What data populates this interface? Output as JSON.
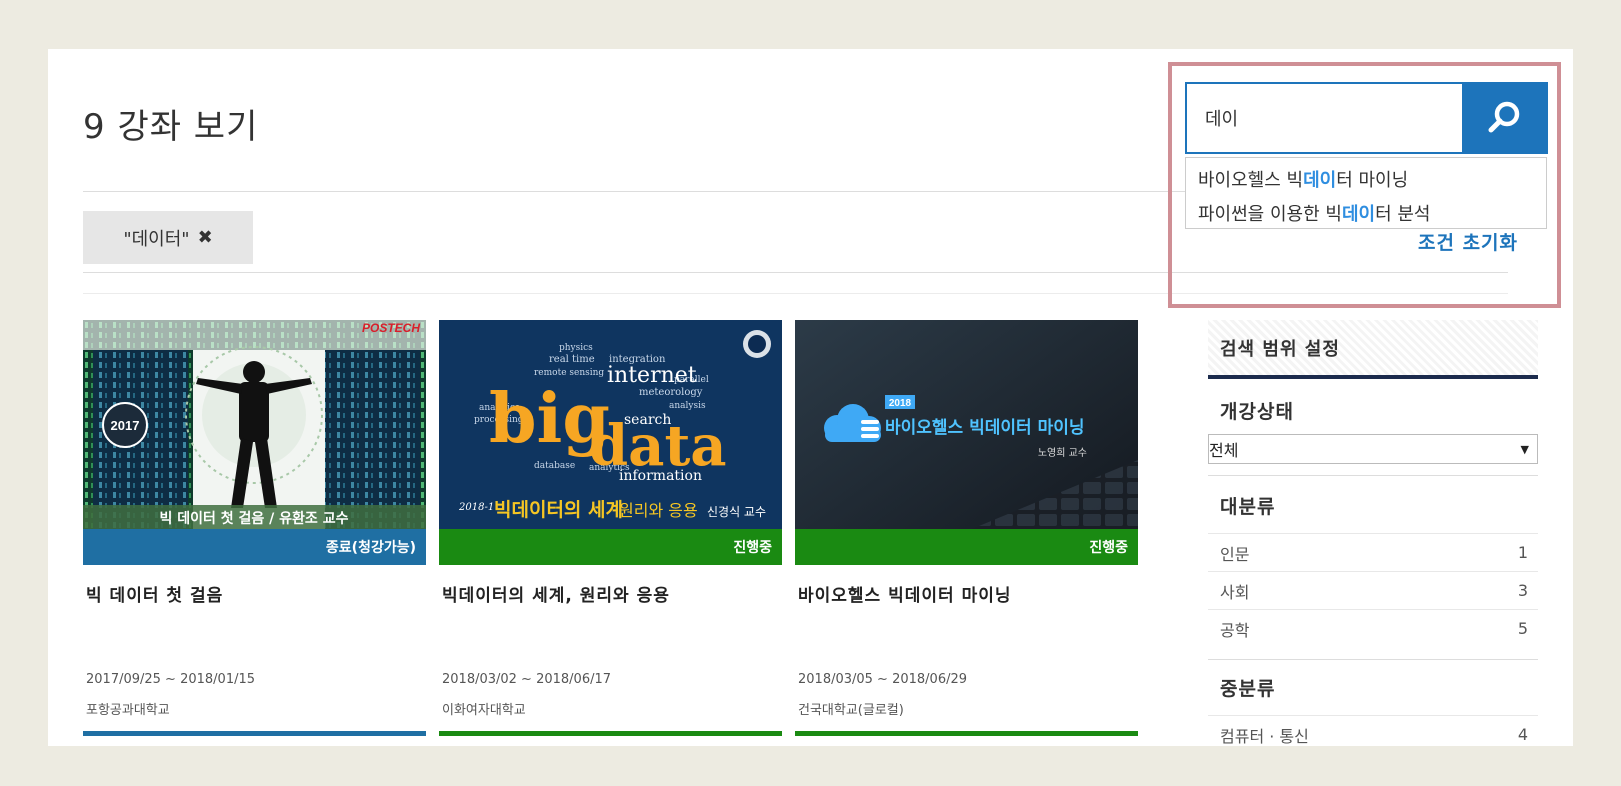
{
  "header": {
    "title": "9 강좌 보기"
  },
  "filter": {
    "chip_label": "\"데이터\"",
    "remove_icon": "✖"
  },
  "search": {
    "value": "데이",
    "placeholder": "",
    "icon": "search-icon",
    "suggestions": [
      {
        "prefix": "바이오헬스 빅",
        "match": "데이",
        "suffix": "터 마이닝"
      },
      {
        "prefix": "파이썬을 이용한 빅",
        "match": "데이",
        "suffix": "터 분석"
      }
    ],
    "reset_label": "조건 초기화"
  },
  "cards": [
    {
      "thumb": {
        "brand": "POSTECH",
        "year": "2017",
        "caption": "빅 데이터 첫 걸음 / 유환조 교수"
      },
      "status": "종료(청강가능)",
      "status_color": "#1f6fa3",
      "title": "빅 데이터 첫 걸음",
      "dates": "2017/09/25 ~ 2018/01/15",
      "school": "포항공과대학교"
    },
    {
      "thumb": {
        "big": "big",
        "data": "data",
        "w1": "internet",
        "w2": "search",
        "w3": "information",
        "term": "2018-1",
        "caption_a": "빅데이터의 세계",
        "caption_b": "원리와 응용",
        "prof": "신경식 교수"
      },
      "status": "진행중",
      "status_color": "#1a8a12",
      "title": "빅데이터의 세계, 원리와 응용",
      "dates": "2018/03/02 ~ 2018/06/17",
      "school": "이화여자대학교"
    },
    {
      "thumb": {
        "year": "2018",
        "caption": "바이오헬스 빅데이터 마이닝",
        "prof": "노영희 교수"
      },
      "status": "진행중",
      "status_color": "#1a8a12",
      "title": "바이오헬스 빅데이터 마이닝",
      "dates": "2018/03/05 ~ 2018/06/29",
      "school": "건국대학교(글로컬)"
    }
  ],
  "sidebar": {
    "heading": "검색 범위 설정",
    "status_label": "개강상태",
    "status_select": "전체",
    "major_label": "대분류",
    "major_items": [
      {
        "name": "인문",
        "count": "1"
      },
      {
        "name": "사회",
        "count": "3"
      },
      {
        "name": "공학",
        "count": "5"
      }
    ],
    "middle_label": "중분류",
    "middle_items": [
      {
        "name": "컴퓨터 · 통신",
        "count": "4"
      }
    ]
  },
  "colors": {
    "accent": "#1d74bb",
    "highlight_border": "#cf8f95",
    "green": "#1a8a12",
    "blue_status": "#1f6fa3"
  }
}
